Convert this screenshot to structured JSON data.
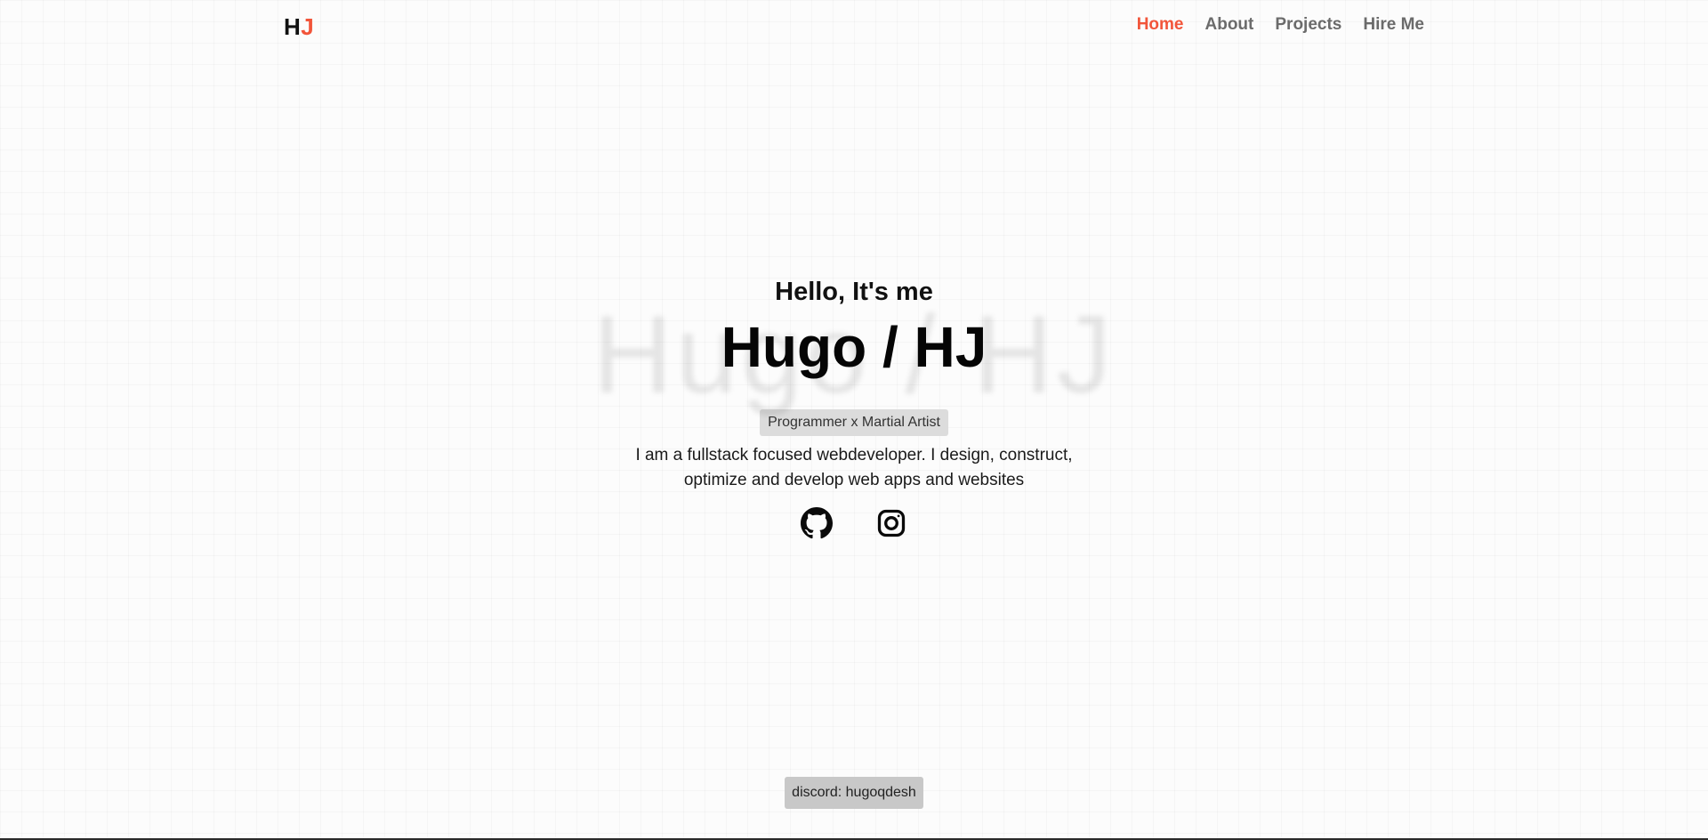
{
  "header": {
    "logo_first": "H",
    "logo_second": "J",
    "nav": [
      {
        "label": "Home",
        "active": true
      },
      {
        "label": "About",
        "active": false
      },
      {
        "label": "Projects",
        "active": false
      },
      {
        "label": "Hire Me",
        "active": false
      }
    ]
  },
  "hero": {
    "greeting": "Hello, It's me",
    "name_ghost": "Hugo / HJ",
    "name": "Hugo / HJ",
    "tagline": "Programmer x Martial Artist",
    "bio": "I am a fullstack focused webdeveloper. I design, construct, optimize and develop web apps and websites",
    "socials": [
      "github-icon",
      "instagram-icon"
    ]
  },
  "footer": {
    "discord": "discord: hugoqdesh"
  },
  "colors": {
    "accent": "#f2553a",
    "nav_inactive": "#6b6b6b",
    "tagline_bg": "#dcdcdc",
    "discord_bg": "#c8c8c8"
  }
}
